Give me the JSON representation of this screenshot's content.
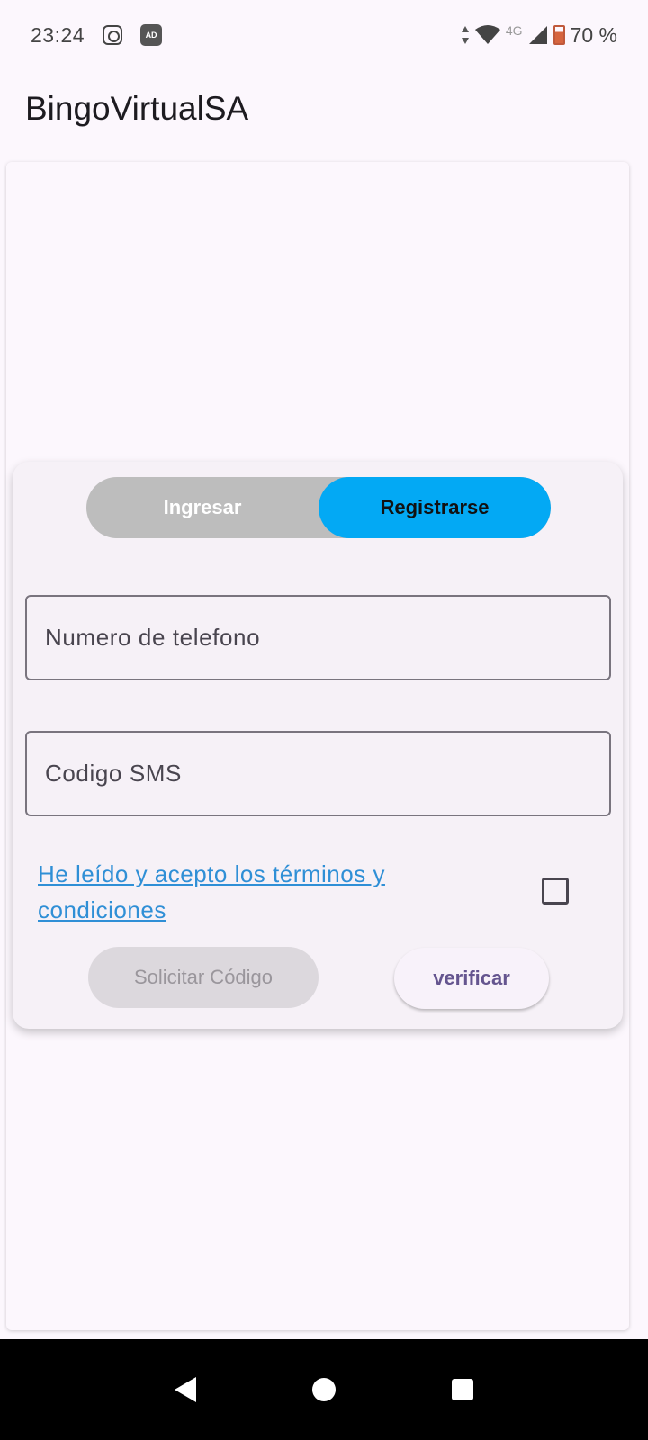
{
  "status_bar": {
    "time": "23:24",
    "left_icons": [
      "instagram-icon",
      "ad-blocker-icon"
    ],
    "ad_icon_text": "AD",
    "network_type": "4G",
    "right_icons": [
      "data-arrows-icon",
      "wifi-icon",
      "signal-icon",
      "battery-icon"
    ],
    "battery": "70 %"
  },
  "app_bar": {
    "title": "BingoVirtualSA"
  },
  "form": {
    "toggle": {
      "left_label": "Ingresar",
      "right_label": "Registrarse",
      "selected": "Registrarse"
    },
    "phone_field": {
      "placeholder": "Numero de telefono",
      "value": ""
    },
    "sms_field": {
      "placeholder": "Codigo SMS",
      "value": ""
    },
    "terms_label": "He leído y acepto los términos y condiciones",
    "terms_checked": false,
    "request_code_label": "Solicitar Código",
    "verify_label": "verificar"
  },
  "colors": {
    "accent": "#03a9f4",
    "link": "#2f8fd6",
    "verify_text": "#65558f"
  },
  "nav_bar": {
    "buttons": [
      "back-icon",
      "home-icon",
      "recents-icon"
    ]
  }
}
